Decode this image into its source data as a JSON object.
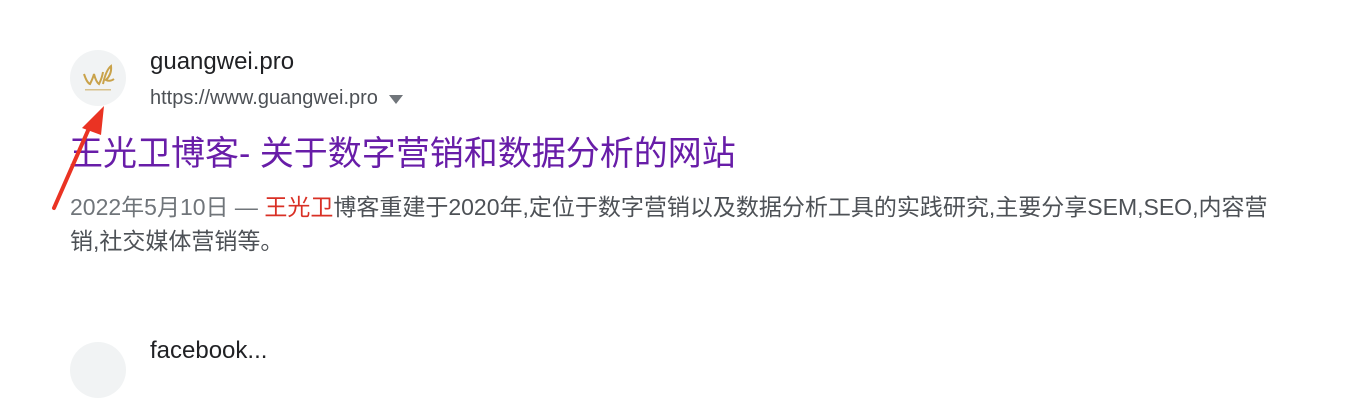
{
  "result": {
    "site_name": "guangwei.pro",
    "site_url": "https://www.guangwei.pro",
    "title": "王光卫博客- 关于数字营销和数据分析的网站",
    "snippet_date": "2022年5月10日",
    "snippet_separator": " — ",
    "snippet_highlight": "王光卫",
    "snippet_text": "博客重建于2020年,定位于数字营销以及数据分析工具的实践研究,主要分享SEM,SEO,内容营销,社交媒体营销等。",
    "favicon_icon": "wl-logo-icon"
  },
  "next_result": {
    "site_name": "facebook..."
  },
  "colors": {
    "title_visited": "#681da8",
    "highlight": "#d93025",
    "arrow": "#ea3323"
  }
}
